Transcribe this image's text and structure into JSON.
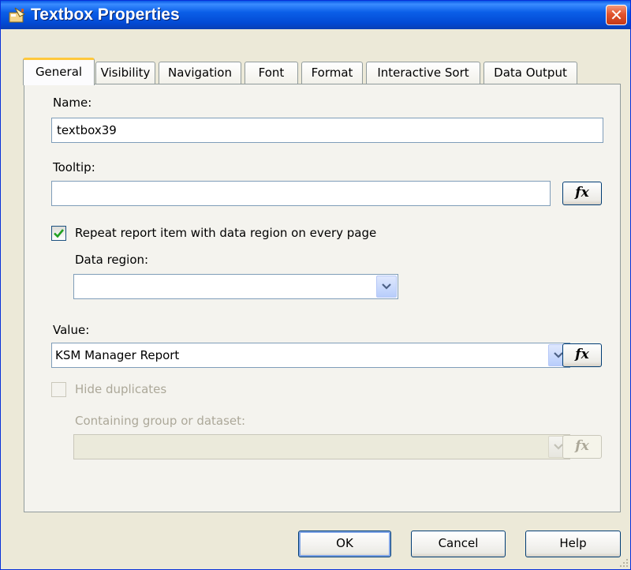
{
  "window": {
    "title": "Textbox Properties",
    "close_symbol": "✕"
  },
  "tabs": [
    {
      "label": "General",
      "active": true
    },
    {
      "label": "Visibility"
    },
    {
      "label": "Navigation"
    },
    {
      "label": "Font"
    },
    {
      "label": "Format"
    },
    {
      "label": "Interactive Sort"
    },
    {
      "label": "Data Output"
    }
  ],
  "general": {
    "name_label": "Name:",
    "name_value": "textbox39",
    "tooltip_label": "Tooltip:",
    "tooltip_value": "",
    "fx_label": "fx",
    "repeat_label": "Repeat report item with data region on every page",
    "repeat_checked": true,
    "data_region_label": "Data region:",
    "data_region_value": "",
    "value_label": "Value:",
    "value_value": "KSM Manager Report",
    "hide_duplicates_label": "Hide duplicates",
    "hide_duplicates_checked": false,
    "containing_group_label": "Containing group or dataset:",
    "containing_group_value": ""
  },
  "buttons": {
    "ok": "OK",
    "cancel": "Cancel",
    "help": "Help"
  },
  "colors": {
    "title_blue": "#0249d3",
    "close_red": "#e2542e",
    "check_green": "#21a121",
    "tab_highlight": "#ffc83c"
  }
}
